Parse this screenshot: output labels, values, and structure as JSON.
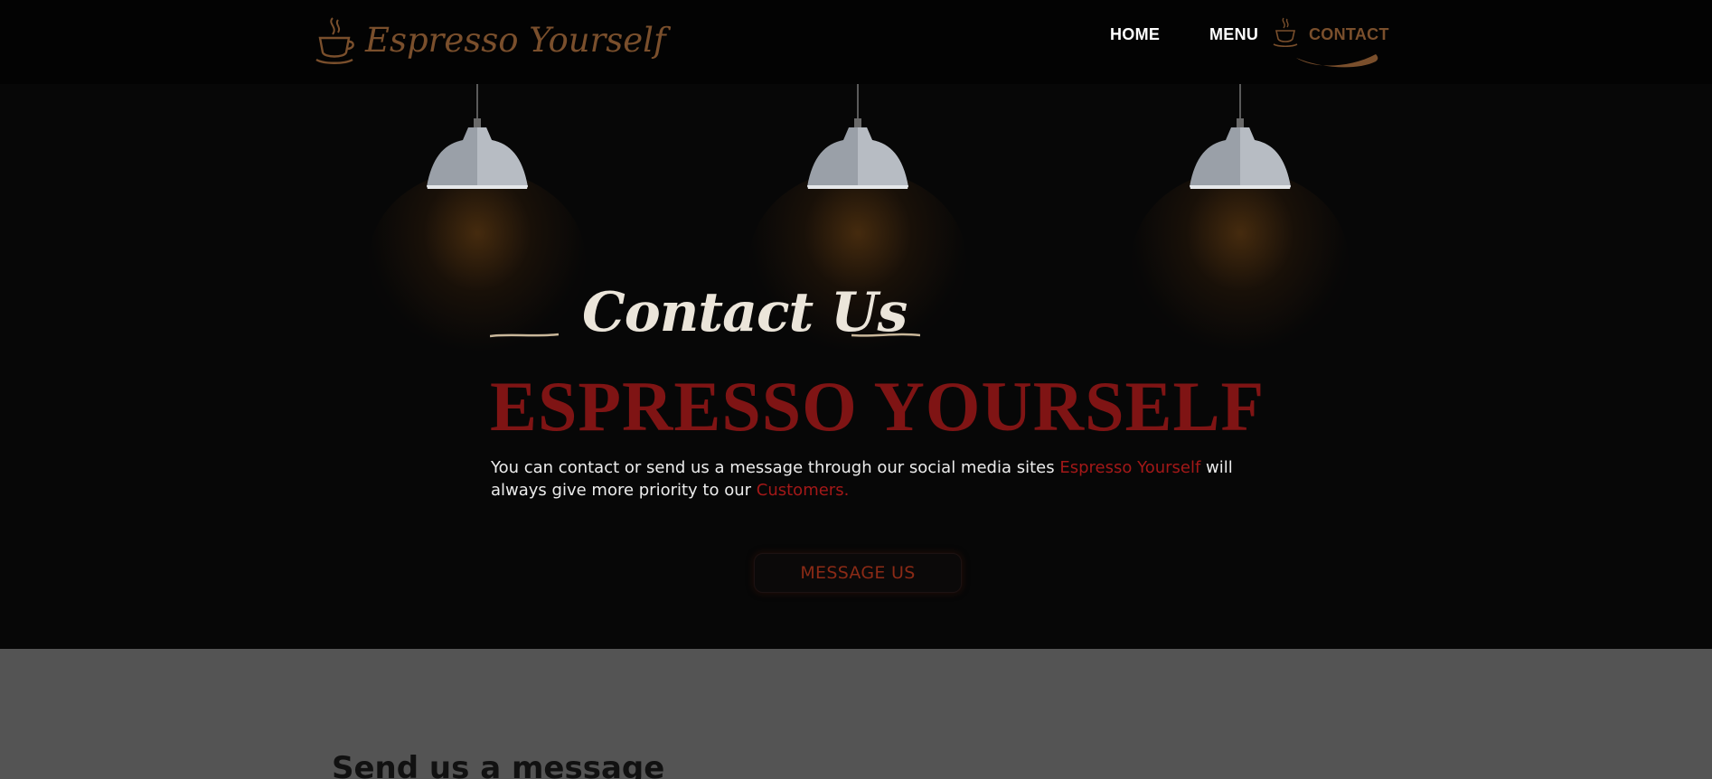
{
  "brand": {
    "name": "Espresso Yourself",
    "icon": "coffee-cup-icon",
    "color": "#7a4f2c"
  },
  "nav": {
    "items": [
      {
        "label": "HOME",
        "active": false
      },
      {
        "label": "MENU",
        "active": false
      },
      {
        "label": "CONTACT",
        "active": true
      }
    ],
    "active_icon": "coffee-cup-icon",
    "active_color": "#7a4f2c"
  },
  "hero": {
    "title": "Contact Us",
    "heading": "ESPRESSO YOURSELF",
    "text_before": "You can contact or send us a message through our social media sites ",
    "text_highlight1": "Espresso Yourself",
    "text_middle": " will always give more priority to our ",
    "text_highlight2": "Customers.",
    "button_label": "MESSAGE US",
    "heading_color": "#7f1414",
    "highlight_color": "#a31818"
  },
  "form_section": {
    "heading": "Send us a message"
  }
}
